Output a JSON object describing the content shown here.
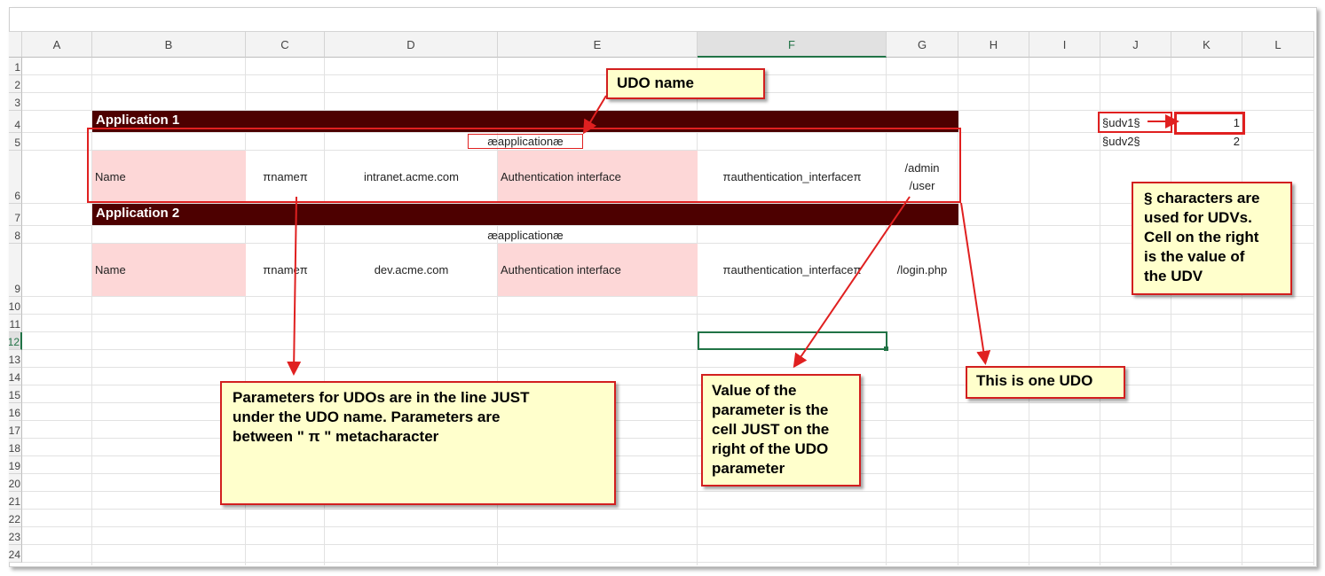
{
  "columns": [
    "A",
    "B",
    "C",
    "D",
    "E",
    "F",
    "G",
    "H",
    "I",
    "J",
    "K",
    "L"
  ],
  "rows": [
    "1",
    "2",
    "3",
    "4",
    "5",
    "6",
    "7",
    "8",
    "9",
    "10",
    "11",
    "12",
    "13",
    "14",
    "15",
    "16",
    "17",
    "18",
    "19",
    "20",
    "21",
    "22",
    "23",
    "24"
  ],
  "selected_column": "F",
  "selected_row": "12",
  "app1": {
    "title": "Application 1",
    "udo_name": "æapplicationæ",
    "name_label": "Name",
    "name_param": "πnameπ",
    "name_value": "intranet.acme.com",
    "auth_label": "Authentication interface",
    "auth_param": "πauthentication_interfaceπ",
    "auth_value_line1": "/admin",
    "auth_value_line2": "/user"
  },
  "app2": {
    "title": "Application 2",
    "udo_name": "æapplicationæ",
    "name_label": "Name",
    "name_param": "πnameπ",
    "name_value": "dev.acme.com",
    "auth_label": "Authentication interface",
    "auth_param": "πauthentication_interfaceπ",
    "auth_value": "/login.php"
  },
  "udvs": [
    {
      "name": "§udv1§",
      "value": "1"
    },
    {
      "name": "§udv2§",
      "value": "2"
    }
  ],
  "callouts": {
    "udo_name": "UDO name",
    "udv_line1": "§ characters are",
    "udv_line2": "used for UDVs.",
    "udv_line3": "Cell on the right",
    "udv_line4": "is the value of",
    "udv_line5": "the UDV",
    "params_line1": "Parameters for UDOs are in the line JUST",
    "params_line2": "under the UDO name. Parameters are",
    "params_line3": "between \" π \" metacharacter",
    "value_line1": "Value of the",
    "value_line2": "parameter is the",
    "value_line3": "cell JUST on the",
    "value_line4": "right of the UDO",
    "value_line5": "parameter",
    "one_udo": "This is one UDO"
  },
  "colors": {
    "band": "#4d0000",
    "pink": "#fdd7d7",
    "callout_fill": "#ffffcc",
    "callout_border": "#d21f1f",
    "selection": "#217346"
  }
}
